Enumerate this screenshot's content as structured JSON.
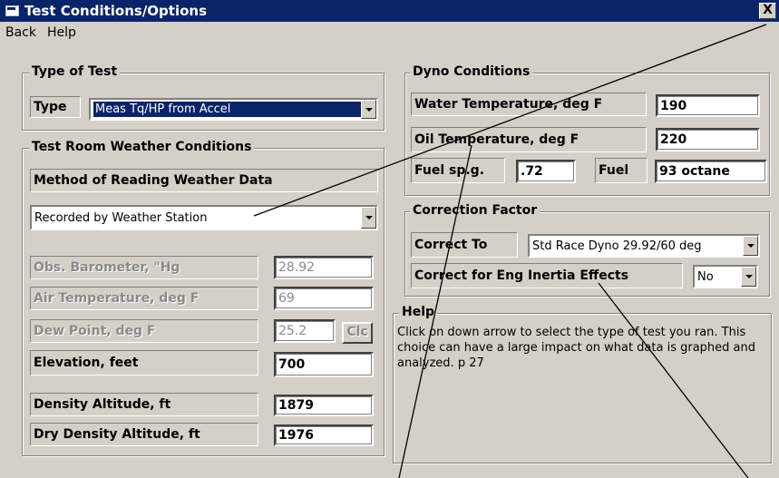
{
  "window": {
    "title": "Test Conditions/Options",
    "close_label": "X"
  },
  "menu": [
    "Back",
    "Help"
  ],
  "type_of_test": {
    "legend": "Type of Test",
    "type_label": "Type",
    "type_value": "Meas Tq/HP from Accel"
  },
  "weather": {
    "legend": "Test Room Weather Conditions",
    "method_label": "Method of Reading Weather Data",
    "method_value": "Recorded by Weather Station",
    "barometer_label": "Obs. Barometer, \"Hg",
    "barometer_value": "28.92",
    "air_temp_label": "Air Temperature, deg F",
    "air_temp_value": "69",
    "dew_point_label": "Dew Point, deg F",
    "dew_point_value": "25.2",
    "clc_label": "Clc",
    "elevation_label": "Elevation, feet",
    "elevation_value": "700",
    "density_alt_label": "Density Altitude, ft",
    "density_alt_value": "1879",
    "dry_density_alt_label": "Dry Density Altitude, ft",
    "dry_density_alt_value": "1976"
  },
  "dyno": {
    "legend": "Dyno Conditions",
    "water_temp_label": "Water Temperature, deg F",
    "water_temp_value": "190",
    "oil_temp_label": "Oil Temperature, deg F",
    "oil_temp_value": "220",
    "fuel_spg_label": "Fuel sp.g.",
    "fuel_spg_value": ".72",
    "fuel_label": "Fuel",
    "fuel_value": "93 octane"
  },
  "correction": {
    "legend": "Correction Factor",
    "correct_to_label": "Correct To",
    "correct_to_value": "Std Race Dyno 29.92/60 deg",
    "inertia_label": "Correct for Eng Inertia Effects",
    "inertia_value": "No"
  },
  "help": {
    "legend": "Help",
    "text": "Click on down arrow to select the type of test you ran.  This choice can have a large impact on what data is graphed and analyzed.  p 27"
  },
  "colors": {
    "titlebar": "#0a246a",
    "window": "#d4d0c8",
    "disabled_text": "#8a8a8a"
  }
}
